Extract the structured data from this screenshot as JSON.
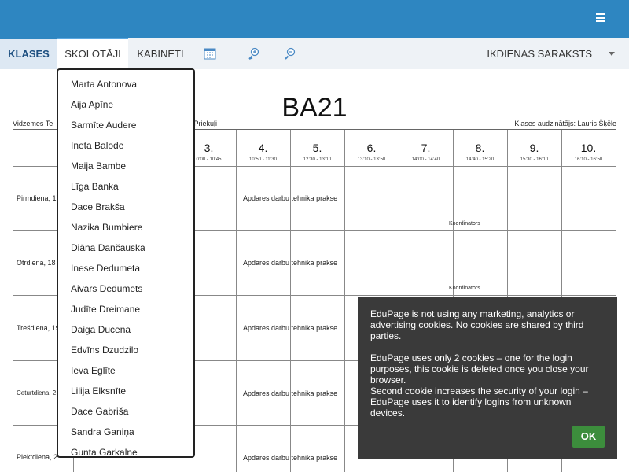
{
  "nav": {
    "tabs": [
      "KLASES",
      "SKOLOTĀJI",
      "KABINETI"
    ],
    "daily_label": "IKDIENAS SARAKSTS",
    "icons": [
      "calendar-icon",
      "zoom-in-icon",
      "zoom-out-icon"
    ]
  },
  "timetable": {
    "class_name": "BA21",
    "school": "Vidzemes Te",
    "school_address_tail": "e 9, Priekuļi",
    "class_teacher": "Klases audzinātājs: Lauris Šķēle",
    "periods": [
      {
        "num": "3.",
        "time": "0:00 - 10:45"
      },
      {
        "num": "4.",
        "time": "10:50 - 11:30"
      },
      {
        "num": "5.",
        "time": "12:30 - 13:10"
      },
      {
        "num": "6.",
        "time": "13:10 - 13:50"
      },
      {
        "num": "7.",
        "time": "14:00 - 14:40"
      },
      {
        "num": "8.",
        "time": "14:40 - 15:20"
      },
      {
        "num": "9.",
        "time": "15:30 - 16:10"
      },
      {
        "num": "10.",
        "time": "16:10 - 16:50"
      }
    ],
    "days": [
      "Pirmdiena, 17",
      "Otrdiena, 18",
      "Trešdiena, 19",
      "Ceturtdiena, 2",
      "Piektdiena, 2"
    ],
    "lesson": "Apdares darbu tehnika prakse",
    "coordinator": "Koordinators"
  },
  "teachers_dropdown": [
    "Marta Antonova",
    "Aija Apīne",
    "Sarmīte Audere",
    "Ineta Balode",
    "Maija Bambe",
    "Līga Banka",
    "Dace Brakša",
    "Nazika Bumbiere",
    "Diāna Dančauska",
    "Inese Dedumeta",
    "Aivars Dedumets",
    "Judīte Dreimane",
    "Daiga Ducena",
    "Edvīns Dzudzilo",
    "Ieva Eglīte",
    "Lilija Elksnīte",
    "Dace Gabriša",
    "Sandra Ganiņa",
    "Gunta Garkalne"
  ],
  "cookie": {
    "p1": "EduPage is not using any marketing, analytics or advertising cookies. No cookies are shared by third parties.",
    "p2": "EduPage uses only 2 cookies – one for the login purposes, this cookie is deleted once you close your browser.",
    "p3": "Second cookie increases the security of your login – EduPage uses it to identify logins from unknown devices.",
    "ok_label": "OK"
  }
}
